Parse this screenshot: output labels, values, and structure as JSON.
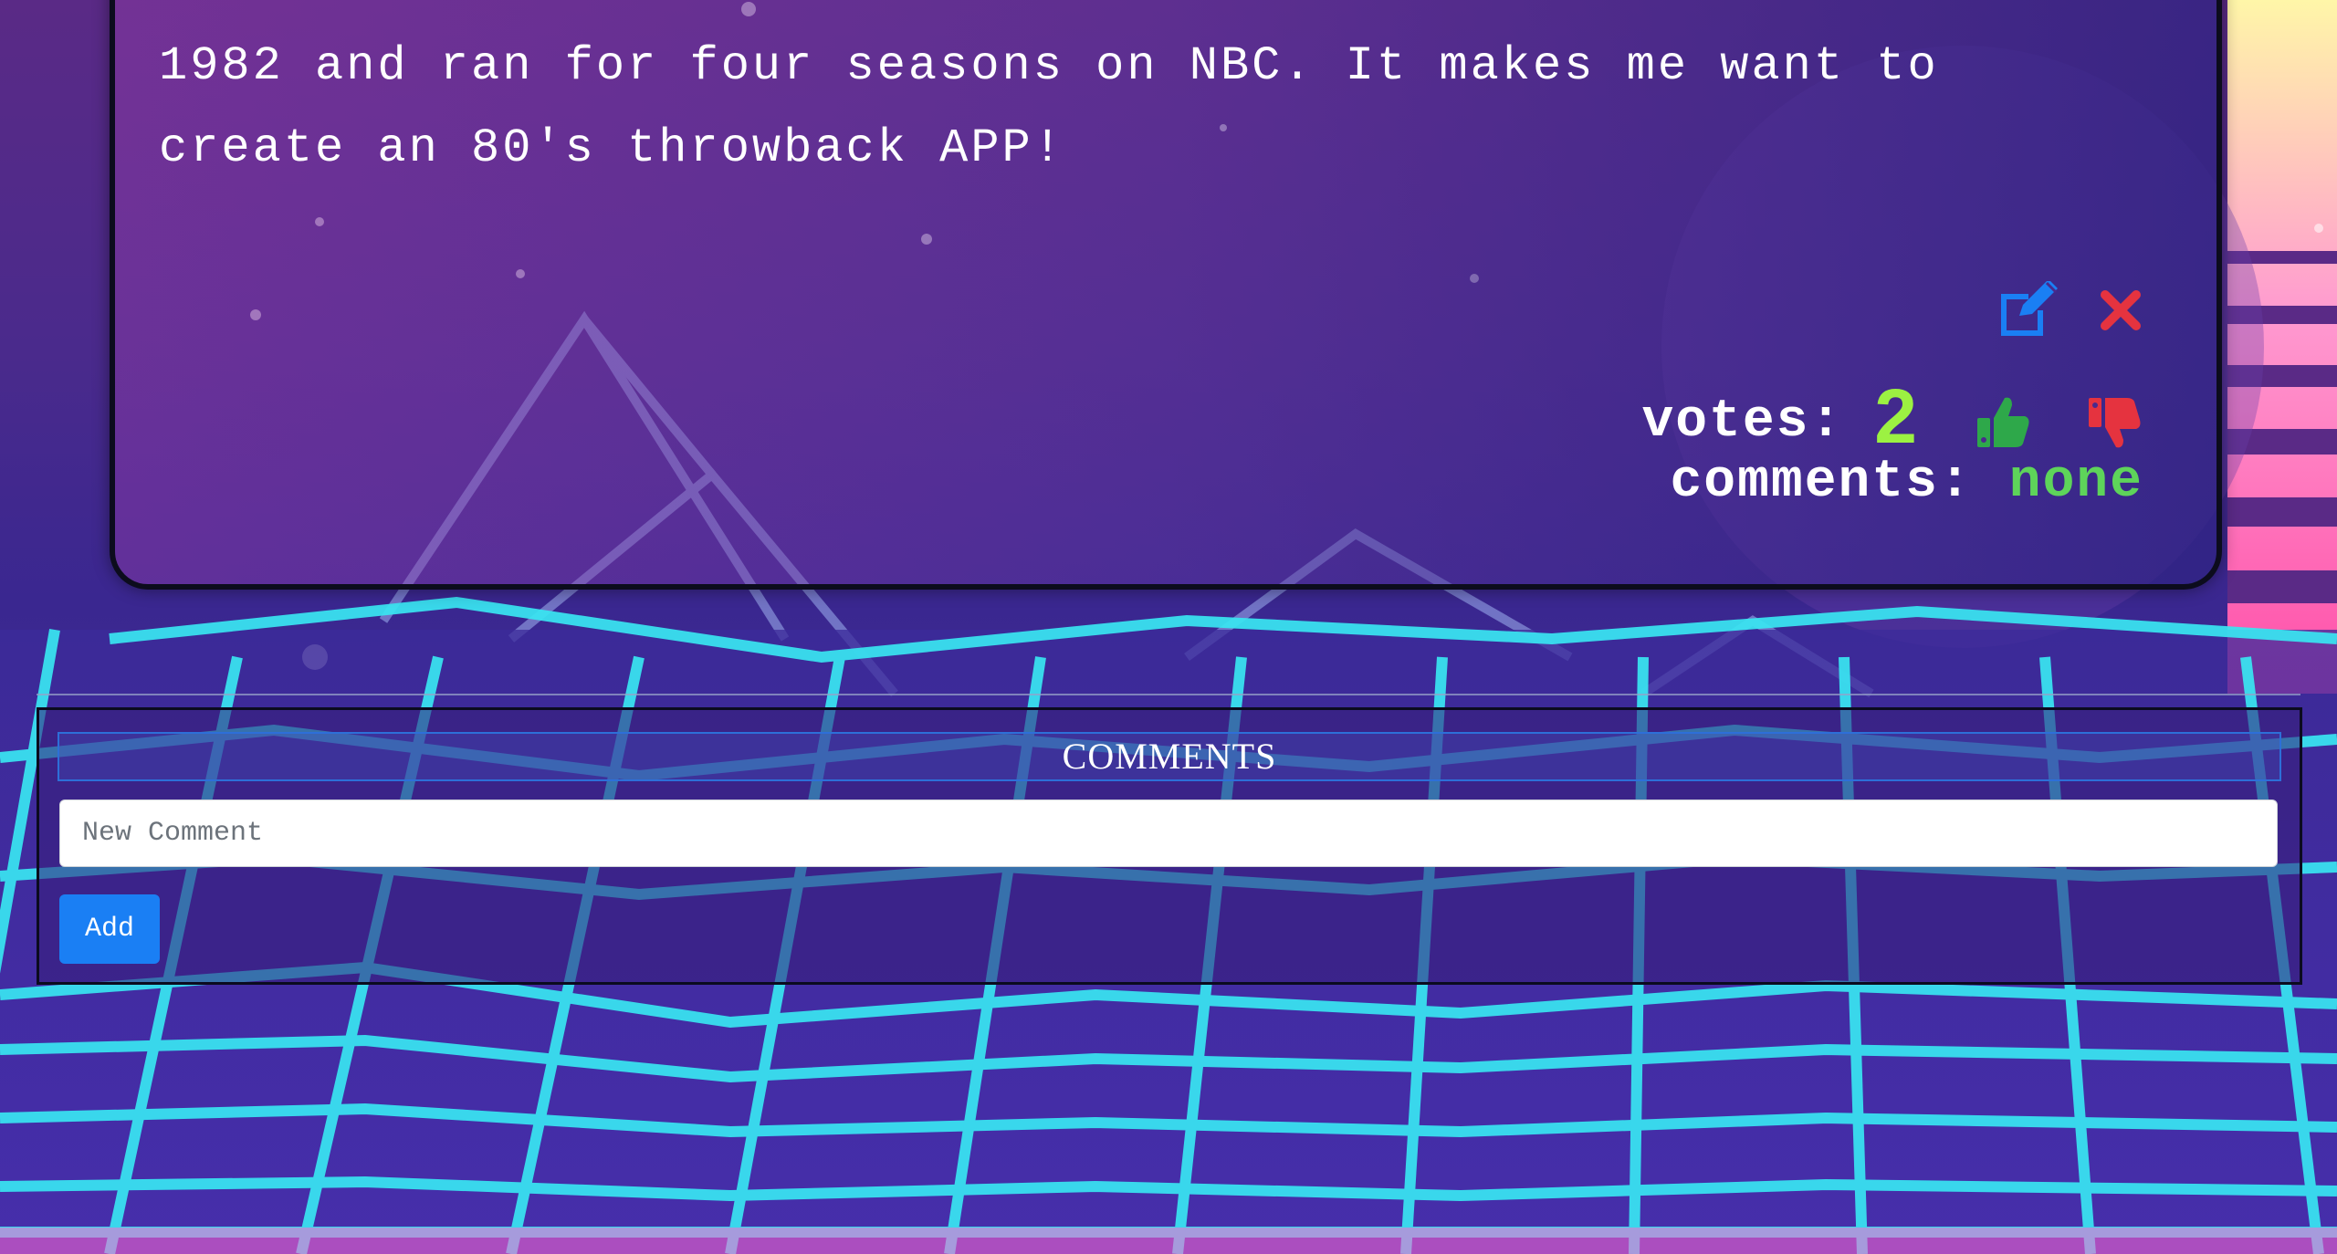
{
  "post": {
    "body": "1982 and ran for four seasons on NBC. It makes me want to\ncreate an 80's throwback APP!",
    "votes_label": "votes:",
    "votes_count": "2",
    "comments_label": "comments:",
    "comments_value": "none"
  },
  "icons": {
    "edit": "edit-icon",
    "delete": "close-icon",
    "upvote": "thumbs-up-icon",
    "downvote": "thumbs-down-icon"
  },
  "colors": {
    "edit": "#1a7ff4",
    "delete": "#e5333f",
    "upvote": "#2ea84a",
    "downvote": "#e5333f",
    "vote_count": "#9cf142",
    "comments_none": "#5ed45a",
    "add_button": "#1a7ff4",
    "grid_glow": "#39e6f2"
  },
  "comments": {
    "header": "COMMENTS",
    "input_placeholder": "New Comment",
    "input_value": "",
    "add_label": "Add"
  }
}
